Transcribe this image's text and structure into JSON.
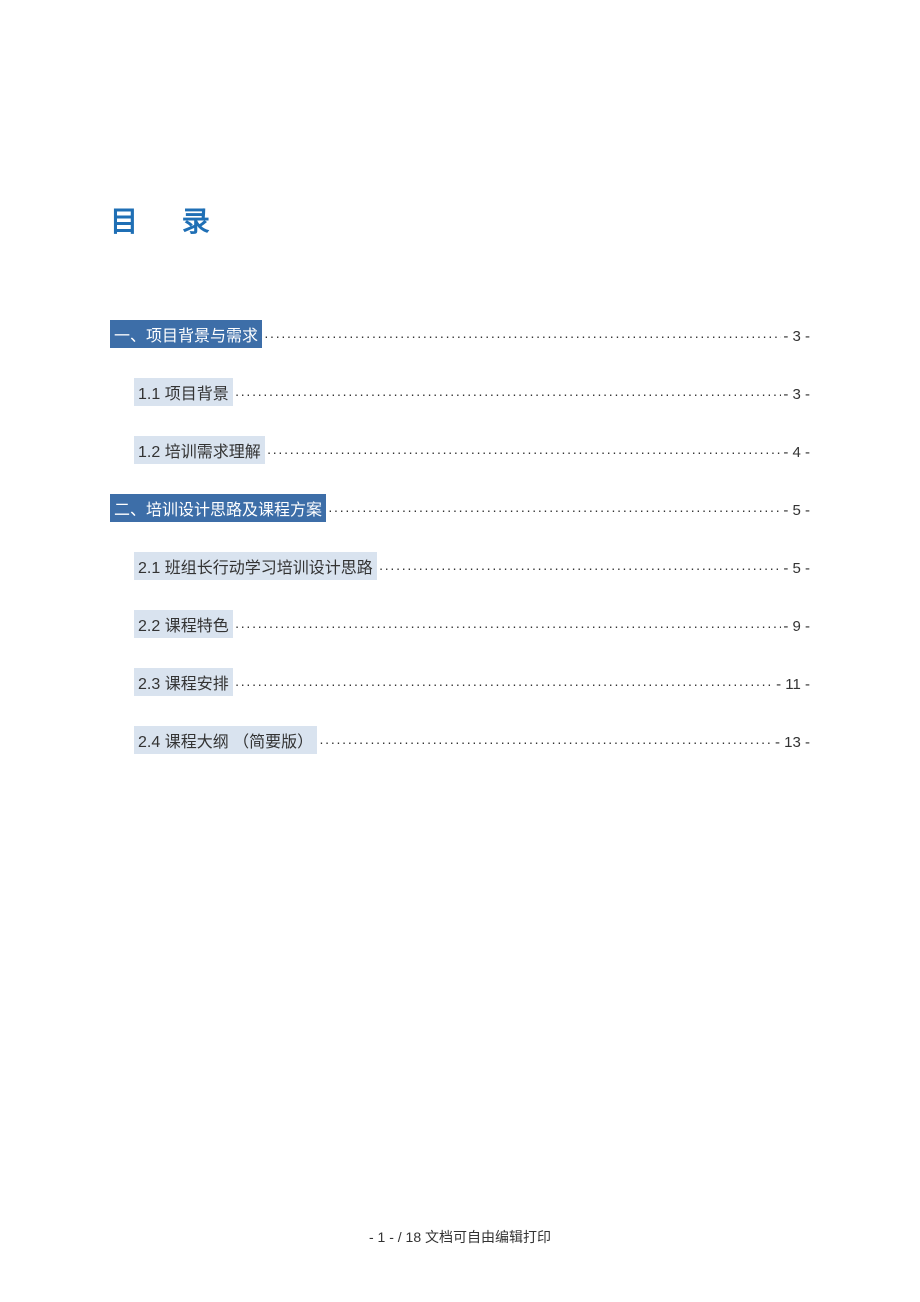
{
  "toc": {
    "title": "目  录",
    "entries": [
      {
        "label": "一、项目背景与需求",
        "page": "- 3 -",
        "highlight": "dark",
        "sub": false
      },
      {
        "label": "1.1 项目背景",
        "page": "- 3 -",
        "highlight": "light",
        "sub": true
      },
      {
        "label": "1.2 培训需求理解",
        "page": "- 4 -",
        "highlight": "light",
        "sub": true
      },
      {
        "label": "二、培训设计思路及课程方案",
        "page": "- 5 -",
        "highlight": "dark",
        "sub": false
      },
      {
        "label": "2.1 班组长行动学习培训设计思路",
        "page": "- 5 -",
        "highlight": "light",
        "sub": true
      },
      {
        "label": "2.2 课程特色",
        "page": "- 9 -",
        "highlight": "light",
        "sub": true
      },
      {
        "label": "2.3 课程安排",
        "page": "- 11 -",
        "highlight": "light",
        "sub": true
      },
      {
        "label": "2.4 课程大纲  （简要版）",
        "page": "- 13 -",
        "highlight": "light",
        "sub": true
      }
    ]
  },
  "footer": {
    "text": "- 1 -  / 18 文档可自由编辑打印"
  }
}
